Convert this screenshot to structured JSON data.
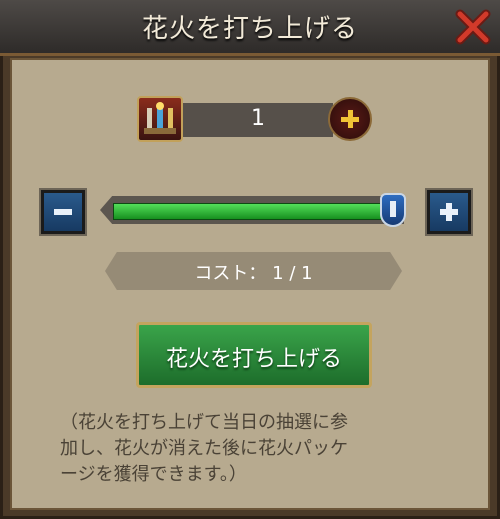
{
  "dialog": {
    "title": "花火を打ち上げる"
  },
  "item": {
    "icon": "fireworks-icon",
    "quantity": "1"
  },
  "slider": {
    "value_fraction": 1.0,
    "fill_color": "#2fbf3a"
  },
  "cost": {
    "label": "コスト： 1 / 1"
  },
  "launch_button": {
    "label": "花火を打ち上げる"
  },
  "note": {
    "line1": "（花火を打ち上げて当日の抽選に参",
    "line2": "加し、花火が消えた後に花火パッケ",
    "line3": "ージを獲得できます。）"
  },
  "colors": {
    "accent_gold": "#c4a45e",
    "close_red": "#d23a2a",
    "button_blue": "#2a5a8c"
  }
}
